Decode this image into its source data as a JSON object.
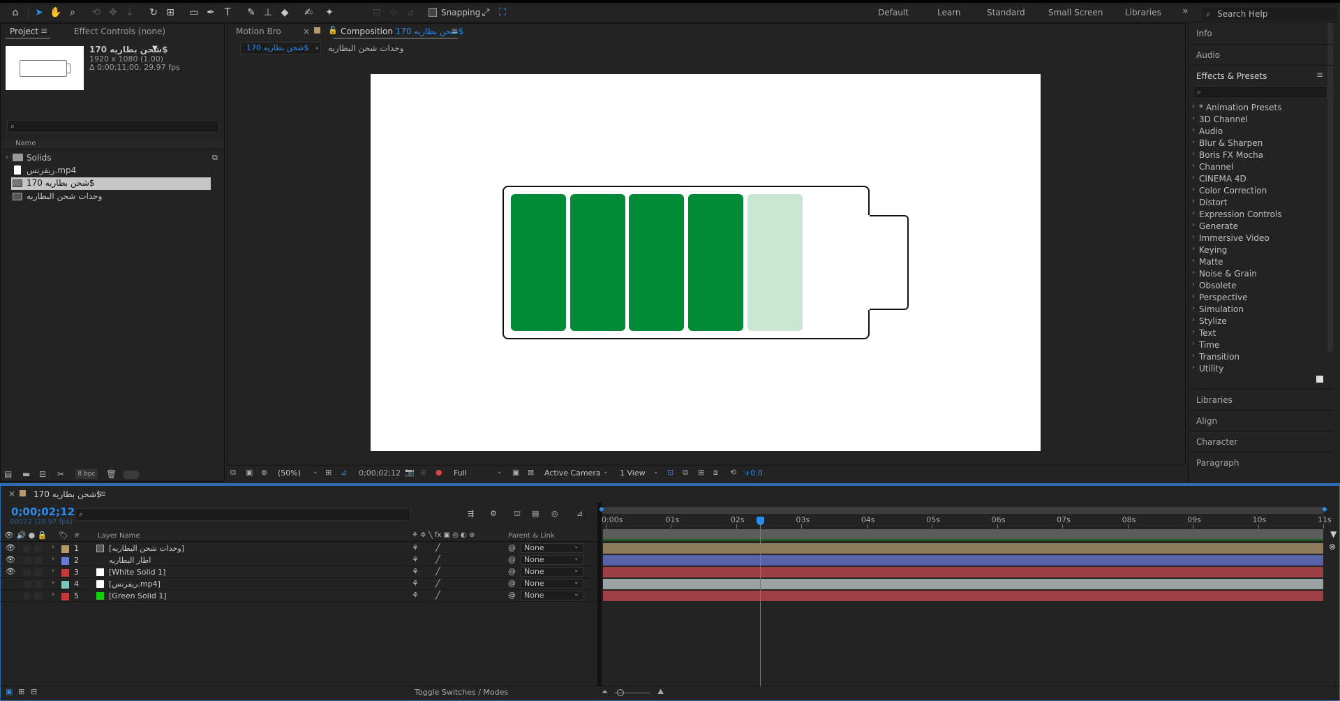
{
  "toolbar": {
    "snapping_label": "Snapping",
    "workspaces": [
      "Default",
      "Learn",
      "Standard",
      "Small Screen",
      "Libraries"
    ],
    "more_label": "»",
    "search_help_placeholder": "Search Help"
  },
  "project_panel": {
    "tab_project": "Project",
    "tab_effect_controls": "Effect Controls (none)",
    "comp_name": "170 شحن بطاريه$",
    "comp_size": "1920 x 1080 (1.00)",
    "comp_duration": "Δ 0;00;11;00, 29.97 fps",
    "column_name": "Name",
    "items": [
      {
        "label": "Solids",
        "icon": "folder-icon"
      },
      {
        "label": "ريفرنس.mp4",
        "icon": "footage-icon"
      },
      {
        "label": "170 شحن بطاريه$",
        "icon": "composition-icon",
        "selected": true
      },
      {
        "label": "وحدات شحن البطاريه",
        "icon": "composition-icon"
      }
    ],
    "bpc_label": "8 bpc"
  },
  "comp_panel": {
    "tab_motion_bro": "Motion Bro",
    "tab_composition_prefix": "Composition",
    "tab_composition_name": "170 شحن بطاريه$",
    "breadcrumb_active": "170 شحن بطاريه$",
    "breadcrumb_next": "وحدات شحن البطاريه",
    "zoom": "(50%)",
    "timecode": "0;00;02;12",
    "resolution": "Full",
    "camera": "Active Camera",
    "views": "1 View",
    "exposure": "+0.0",
    "battery": {
      "cells_full": 4,
      "cells_dim": 1,
      "full_color": "#038a37",
      "dim_color": "#c9e6d2"
    }
  },
  "right_panel": {
    "info": "Info",
    "audio": "Audio",
    "effects_title": "Effects & Presets",
    "effects": [
      "* Animation Presets",
      "3D Channel",
      "Audio",
      "Blur & Sharpen",
      "Boris FX Mocha",
      "Channel",
      "CINEMA 4D",
      "Color Correction",
      "Distort",
      "Expression Controls",
      "Generate",
      "Immersive Video",
      "Keying",
      "Matte",
      "Noise & Grain",
      "Obsolete",
      "Perspective",
      "Simulation",
      "Stylize",
      "Text",
      "Time",
      "Transition",
      "Utility"
    ],
    "libraries": "Libraries",
    "align": "Align",
    "character": "Character",
    "paragraph": "Paragraph"
  },
  "timeline": {
    "tab_name": "170 شحن بطاريه$",
    "current_time": "0;00;02;12",
    "current_frame": "00072 (29.97 fps)",
    "col_layer_name": "Layer Name",
    "col_parent": "Parent & Link",
    "ruler": [
      "0:00s",
      "01s",
      "02s",
      "03s",
      "04s",
      "05s",
      "06s",
      "07s",
      "08s",
      "09s",
      "10s",
      "11s"
    ],
    "layers": [
      {
        "num": "1",
        "name": "[وحدات شحن البطاريه]",
        "label_color": "#b59a6e",
        "icon": "composition-icon",
        "parent": "None",
        "bar_color": "#8c7a5b",
        "visible": true
      },
      {
        "num": "2",
        "name": "اطار البطاريه",
        "label_color": "#6a79d6",
        "icon": "star-icon",
        "parent": "None",
        "bar_color": "#5862a8",
        "visible": true
      },
      {
        "num": "3",
        "name": "[White Solid 1]",
        "label_color": "#c23b3b",
        "icon": "white-solid-icon",
        "parent": "None",
        "bar_color": "#9e3f45",
        "visible": true
      },
      {
        "num": "4",
        "name": "[ريفرنس.mp4]",
        "label_color": "#7fc4bb",
        "icon": "footage-icon",
        "parent": "None",
        "bar_color": "#9aa3a2",
        "visible": false
      },
      {
        "num": "5",
        "name": "[Green Solid 1]",
        "label_color": "#c23b3b",
        "icon": "green-solid-icon",
        "parent": "None",
        "bar_color": "#9e3f45",
        "visible": false
      }
    ],
    "toggle_label": "Toggle Switches / Modes"
  }
}
